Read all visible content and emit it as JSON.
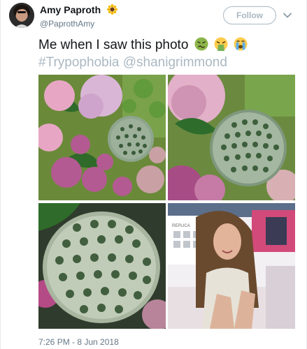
{
  "user": {
    "display_name": "Amy Paproth",
    "handle": "@PaprothAmy",
    "name_emoji": "sunflower-icon"
  },
  "follow_button": {
    "label": "Follow"
  },
  "tweet": {
    "text_main": "Me when I saw this photo",
    "emojis": [
      "nauseated-face-icon",
      "vomiting-face-icon",
      "crying-face-icon"
    ],
    "hashtag": "#Trypophobia",
    "mention": "@shanigrimmond"
  },
  "media": {
    "tiles": [
      "lotus-flower-bouquet",
      "lotus-pod-closeup",
      "lotus-pod-macro",
      "woman-reaction"
    ],
    "sign_text": "REPLICA"
  },
  "timestamp": "7:26 PM - 8 Jun 2018"
}
